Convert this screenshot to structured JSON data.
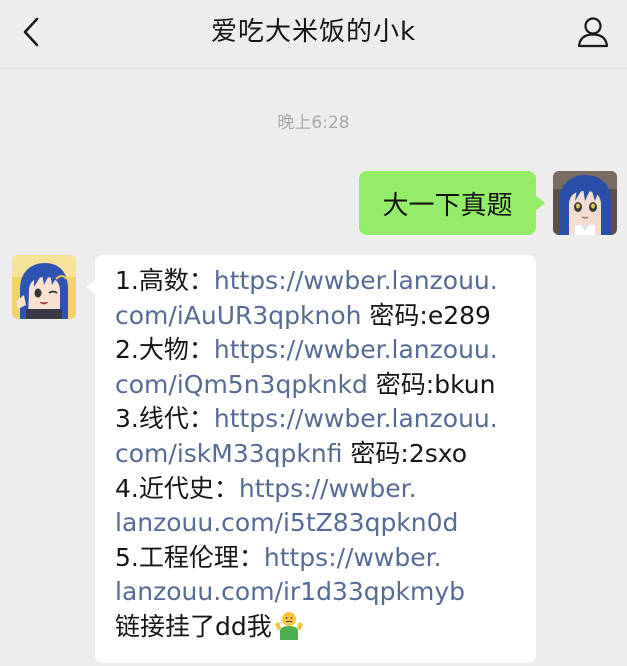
{
  "header": {
    "title": "爱吃大米饭的小k",
    "back_icon": "chevron-left-icon",
    "profile_icon": "person-icon"
  },
  "timestamp": "晚上6:28",
  "messages": {
    "sent": {
      "text": "大一下真题"
    },
    "received": {
      "lines": [
        {
          "label": "1.高数：",
          "link": "https://wwber.lanzouu.",
          "rest": ""
        },
        {
          "label": "",
          "link": "com/iAuUR3qpknoh",
          "rest": " 密码:e289"
        },
        {
          "label": "2.大物：",
          "link": "https://wwber.lanzouu.",
          "rest": ""
        },
        {
          "label": "",
          "link": "com/iQm5n3qpknkd",
          "rest": " 密码:bkun"
        },
        {
          "label": "3.线代：",
          "link": "https://wwber.lanzouu.",
          "rest": ""
        },
        {
          "label": "",
          "link": "com/iskM33qpknfi",
          "rest": " 密码:2sxo"
        },
        {
          "label": "4.近代史：",
          "link": "https://wwber.",
          "rest": ""
        },
        {
          "label": "",
          "link": "lanzouu.com/i5tZ83qpkn0d",
          "rest": ""
        },
        {
          "label": "5.工程伦理：",
          "link": "https://wwber.",
          "rest": ""
        },
        {
          "label": "",
          "link": "lanzouu.com/ir1d33qpkmyb",
          "rest": ""
        },
        {
          "label": "链接挂了dd我",
          "link": "",
          "rest": ""
        }
      ],
      "emoji": "shrug-emoji"
    }
  },
  "colors": {
    "background": "#ededed",
    "sent_bubble": "#95ec69",
    "received_bubble": "#ffffff",
    "link": "#576b95",
    "timestamp": "#a9a9a9"
  }
}
